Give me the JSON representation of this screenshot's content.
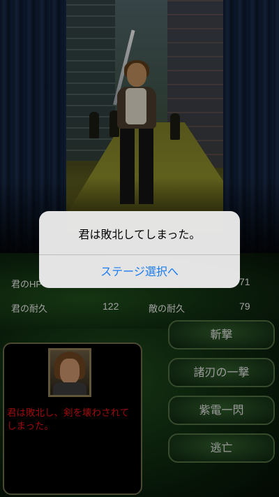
{
  "stats": {
    "player_hp_label": "君のHP",
    "player_hp_value": "",
    "enemy_hp_label": "",
    "enemy_hp_value": "71",
    "player_durability_label": "君の耐久",
    "player_durability_value": "122",
    "enemy_durability_label": "敵の耐久",
    "enemy_durability_value": "79"
  },
  "message": {
    "text": "君は敗北し、剣を壊わされてしまった。"
  },
  "commands": [
    {
      "label": "斬撃"
    },
    {
      "label": "諸刃の一撃"
    },
    {
      "label": "紫電一閃"
    },
    {
      "label": "逃亡"
    }
  ],
  "alert": {
    "title": "君は敗北してしまった。",
    "button": "ステージ選択へ"
  },
  "colors": {
    "alert_button": "#1a7cf0",
    "message_text": "#e01010"
  }
}
